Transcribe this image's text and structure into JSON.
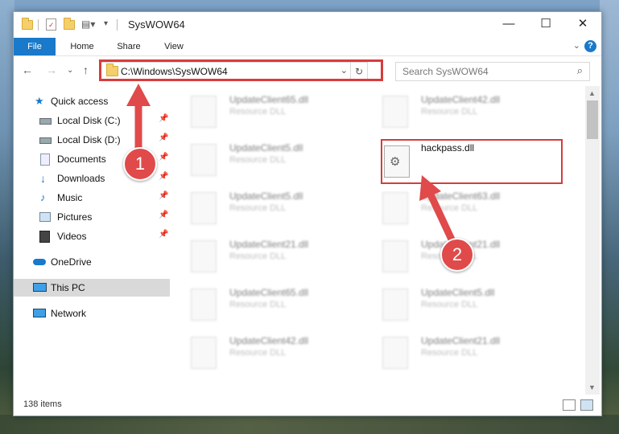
{
  "window": {
    "title": "SysWOW64"
  },
  "ribbon": {
    "tabs": [
      "File",
      "Home",
      "Share",
      "View"
    ]
  },
  "controls": {
    "minimize": "—",
    "maximize": "☐",
    "close": "✕",
    "help": "?"
  },
  "address": {
    "path": "C:\\Windows\\SysWOW64"
  },
  "search": {
    "placeholder": "Search SysWOW64"
  },
  "sidebar": {
    "items": [
      {
        "label": "Quick access",
        "icon": "star-icon"
      },
      {
        "label": "Local Disk (C:)",
        "icon": "drive-icon",
        "pinned": true
      },
      {
        "label": "Local Disk (D:)",
        "icon": "drive-icon",
        "pinned": true
      },
      {
        "label": "Documents",
        "icon": "documents-icon",
        "pinned": true
      },
      {
        "label": "Downloads",
        "icon": "download-icon",
        "pinned": true
      },
      {
        "label": "Music",
        "icon": "music-icon",
        "pinned": true
      },
      {
        "label": "Pictures",
        "icon": "pictures-icon",
        "pinned": true
      },
      {
        "label": "Videos",
        "icon": "videos-icon",
        "pinned": true
      },
      {
        "label": "OneDrive",
        "icon": "cloud-icon"
      },
      {
        "label": "This PC",
        "icon": "computer-icon",
        "selected": true
      },
      {
        "label": "Network",
        "icon": "network-icon"
      }
    ]
  },
  "files": {
    "left": [
      {
        "name": "UpdateClient65.dll",
        "type": "Resource DLL"
      },
      {
        "name": "UpdateClient5.dll",
        "type": "Resource DLL"
      },
      {
        "name": "UpdateClient5.dll",
        "type": "Resource DLL"
      },
      {
        "name": "UpdateClient21.dll",
        "type": "Resource DLL"
      },
      {
        "name": "UpdateClient65.dll",
        "type": "Resource DLL"
      },
      {
        "name": "UpdateClient42.dll",
        "type": "Resource DLL"
      }
    ],
    "right": [
      {
        "name": "UpdateClient42.dll",
        "type": "Resource DLL"
      },
      {
        "name": "hackpass.dll",
        "type": "",
        "highlighted": true
      },
      {
        "name": "UpdateClient63.dll",
        "type": "Resource DLL"
      },
      {
        "name": "UpdateClient21.dll",
        "type": "Resource DLL"
      },
      {
        "name": "UpdateClient5.dll",
        "type": "Resource DLL"
      },
      {
        "name": "UpdateClient21.dll",
        "type": "Resource DLL"
      }
    ]
  },
  "status": {
    "item_count": "138 items"
  },
  "annotations": {
    "badge1": "1",
    "badge2": "2"
  },
  "colors": {
    "accent": "#1979ca",
    "annotation": "#d73c3c"
  }
}
